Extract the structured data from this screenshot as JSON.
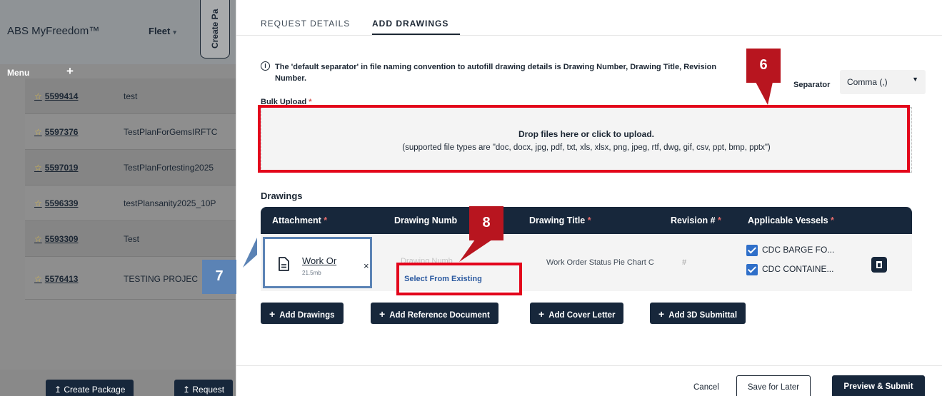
{
  "background": {
    "brand": "ABS MyFreedom™",
    "fleet_label": "Fleet",
    "create_tab_label": "Create Pa",
    "menu_label": "Menu",
    "menu_plus": "+",
    "rows": [
      {
        "num": "5599414",
        "name": "test"
      },
      {
        "num": "5597376",
        "name": "TestPlanForGemsIRFTC"
      },
      {
        "num": "5597019",
        "name": "TestPlanFortesting2025"
      },
      {
        "num": "5596339",
        "name": "testPlansanity2025_10P"
      },
      {
        "num": "5593309",
        "name": "Test"
      },
      {
        "num": "5576413",
        "name": "TESTING PROJEC"
      }
    ],
    "create_package_label": "↥ Create Package",
    "request_label": "↥ Request"
  },
  "tabs": {
    "request_details": "REQUEST DETAILS",
    "add_drawings": "ADD DRAWINGS"
  },
  "info": {
    "icon": "info-icon",
    "text": "The 'default separator' in file naming convention to autofill drawing details is Drawing Number, Drawing Title, Revision Number.",
    "separator_label": "Separator",
    "separator_value": "Comma (,)"
  },
  "bulk_upload": {
    "label": "Bulk Upload",
    "required_mark": "*",
    "drop_title": "Drop files here or click to upload.",
    "drop_subtitle": "(supported file types are \"doc, docx, jpg, pdf, txt, xls, xlsx, png, jpeg, rtf, dwg, gif, csv, ppt, bmp, pptx\")"
  },
  "drawings": {
    "label": "Drawings",
    "columns": {
      "attachment": "Attachment",
      "drawing_number": "Drawing Numb",
      "drawing_title": "Drawing Title",
      "revision": "Revision #",
      "vessels": "Applicable Vessels",
      "required_mark": "*"
    },
    "row": {
      "attachment_name": "Work Or",
      "attachment_size": "21.5mb",
      "remove": "×",
      "drawing_number_placeholder": "Drawing Numb",
      "select_existing": "Select From Existing",
      "drawing_title": "Work Order Status Pie Chart C",
      "revision_placeholder": "#",
      "vessels": [
        "CDC BARGE FO...",
        "CDC CONTAINE..."
      ]
    }
  },
  "actions": {
    "add_drawings": "Add Drawings",
    "add_reference": "Add Reference Document",
    "add_cover": "Add Cover Letter",
    "add_3d": "Add 3D Submittal",
    "plus": "+"
  },
  "footer": {
    "cancel": "Cancel",
    "save": "Save for Later",
    "submit": "Preview & Submit"
  },
  "callouts": {
    "six": "6",
    "seven": "7",
    "eight": "8"
  },
  "colors": {
    "navy": "#17273b",
    "annotation_red": "#e3051b",
    "annotation_blue": "#5b83b5",
    "checkbox_blue": "#2f6fc9"
  }
}
